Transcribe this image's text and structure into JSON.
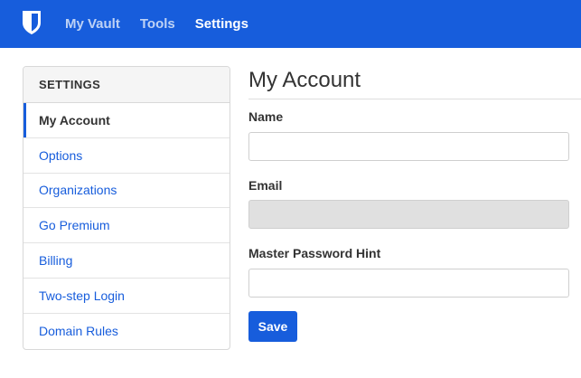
{
  "navbar": {
    "logo_icon": "shield-icon",
    "links": [
      {
        "label": "My Vault",
        "active": false
      },
      {
        "label": "Tools",
        "active": false
      },
      {
        "label": "Settings",
        "active": true
      }
    ]
  },
  "sidebar": {
    "header": "SETTINGS",
    "items": [
      {
        "label": "My Account",
        "active": true
      },
      {
        "label": "Options",
        "active": false
      },
      {
        "label": "Organizations",
        "active": false
      },
      {
        "label": "Go Premium",
        "active": false
      },
      {
        "label": "Billing",
        "active": false
      },
      {
        "label": "Two-step Login",
        "active": false
      },
      {
        "label": "Domain Rules",
        "active": false
      }
    ]
  },
  "main": {
    "title": "My Account",
    "name_label": "Name",
    "name_value": "",
    "email_label": "Email",
    "email_value": "",
    "hint_label": "Master Password Hint",
    "hint_value": "",
    "save_label": "Save"
  },
  "colors": {
    "brand": "#175ddc",
    "disabled_input": "#e0e0e0"
  }
}
